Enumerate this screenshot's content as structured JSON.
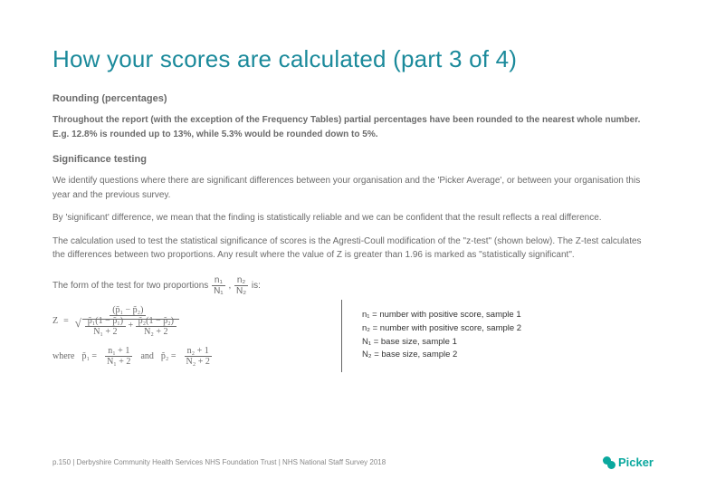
{
  "title": "How your scores are calculated (part 3 of 4)",
  "rounding": {
    "heading": "Rounding (percentages)",
    "body": "Throughout the report (with the exception of the Frequency Tables) partial percentages have been rounded to the nearest whole number. E.g. 12.8% is rounded up to 13%, while 5.3% would be rounded down to 5%."
  },
  "sig": {
    "heading": "Significance testing",
    "p1": "We identify questions where there are significant differences between your organisation and the 'Picker Average', or between your organisation this year and the previous survey.",
    "p2": "By 'significant' difference, we mean that the finding is statistically reliable and we can be confident that the result reflects a real difference.",
    "p3": "The calculation used to test the statistical significance of scores is the Agresti-Coull modification of the \"z-test\" (shown below). The Z-test calculates the differences between two proportions. Any result where the value of Z is greater than 1.96 is marked as \"statistically significant\"."
  },
  "formula": {
    "intro_a": "The form of the test for two proportions ",
    "intro_b": " , ",
    "intro_c": " is:",
    "zvar": "Z",
    "numerator": "(p̃₁ − p̃₂)",
    "d1a": "p̃₁(1 − p̃₁)",
    "d1b": "N₁ + 2",
    "d2a": "p̃₂(1 − p̃₂)",
    "d2b": "N₂ + 2",
    "where": "where",
    "and": "and",
    "p1def_num": "n₁ + 1",
    "p1def_den": "N₁ + 2",
    "p2def_num": "n₂ + 1",
    "p2def_den": "N₂ + 2",
    "ratio1_num": "n₁",
    "ratio1_den": "N₁",
    "ratio2_num": "n₂",
    "ratio2_den": "N₂",
    "p1sym": "p̃₁ =",
    "p2sym": "p̃₂ ="
  },
  "legend": {
    "l1": "n₁ = number with positive score, sample 1",
    "l2": "n₂ = number with positive score, sample 2",
    "l3": "N₁ = base size, sample 1",
    "l4": "N₂ = base size, sample 2"
  },
  "footer": "p.150 | Derbyshire Community Health Services NHS Foundation Trust | NHS National Staff Survey 2018",
  "logo": "Picker"
}
